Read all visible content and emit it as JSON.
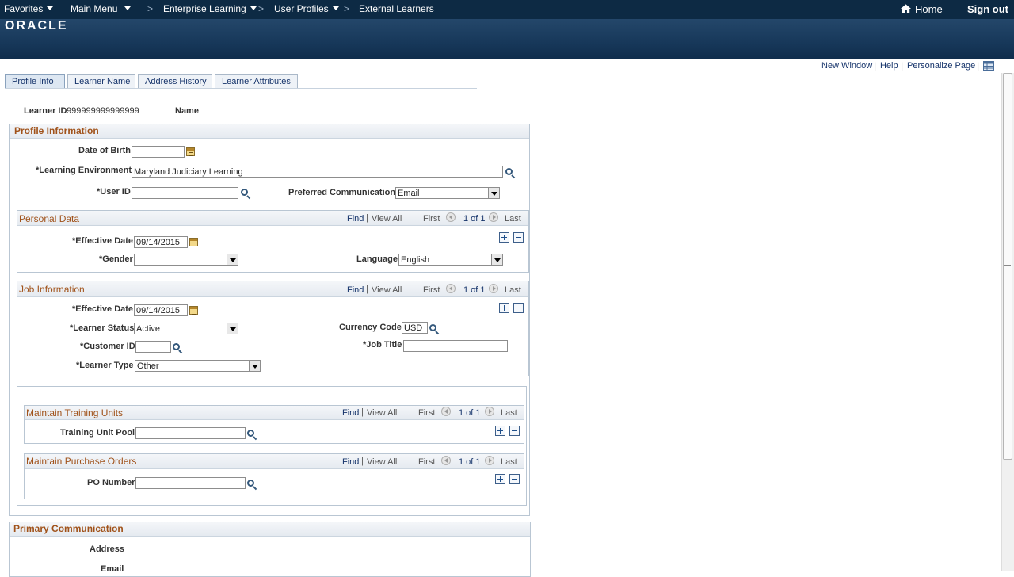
{
  "nav": {
    "favorites": "Favorites",
    "main_menu": "Main Menu",
    "breadcrumbs": [
      "Enterprise Learning",
      "User Profiles",
      "External Learners"
    ],
    "separator": ">",
    "home": "Home",
    "sign_out": "Sign out",
    "logo": "ORACLE"
  },
  "page_links": {
    "new_window": "New Window",
    "help": "Help",
    "personalize": "Personalize Page",
    "separator": "|"
  },
  "tabs": [
    {
      "label": "Profile Info"
    },
    {
      "label": "Learner Name"
    },
    {
      "label": "Address History"
    },
    {
      "label": "Learner Attributes"
    }
  ],
  "header": {
    "learner_id_label": "Learner ID",
    "learner_id_value": "999999999999999",
    "name_label": "Name"
  },
  "profile": {
    "title": "Profile Information",
    "dob_label": "Date of Birth",
    "dob_value": "",
    "env_label": "*Learning Environment",
    "env_value": "Maryland Judiciary Learning",
    "user_id_label": "*User ID",
    "user_id_value": "",
    "pref_comm_label": "Preferred Communication",
    "pref_comm_value": "Email"
  },
  "grid_nav": {
    "find": "Find",
    "view_all": "View All",
    "first": "First",
    "count": "1 of 1",
    "last": "Last",
    "sep": "|"
  },
  "personal": {
    "title": "Personal Data",
    "eff_date_label": "*Effective Date",
    "eff_date_value": "09/14/2015",
    "gender_label": "*Gender",
    "gender_value": "",
    "language_label": "Language",
    "language_value": "English"
  },
  "job": {
    "title": "Job Information",
    "eff_date_label": "*Effective Date",
    "eff_date_value": "09/14/2015",
    "status_label": "*Learner Status",
    "status_value": "Active",
    "currency_label": "Currency Code",
    "currency_value": "USD",
    "customer_label": "*Customer ID",
    "customer_value": "",
    "job_title_label": "*Job Title",
    "job_title_value": "",
    "type_label": "*Learner Type",
    "type_value": "Other"
  },
  "training": {
    "title": "Maintain Training Units",
    "pool_label": "Training Unit Pool",
    "pool_value": ""
  },
  "purchase": {
    "title": "Maintain Purchase Orders",
    "po_label": "PO Number",
    "po_value": ""
  },
  "primary": {
    "title": "Primary Communication",
    "address_label": "Address",
    "email_label": "Email"
  }
}
